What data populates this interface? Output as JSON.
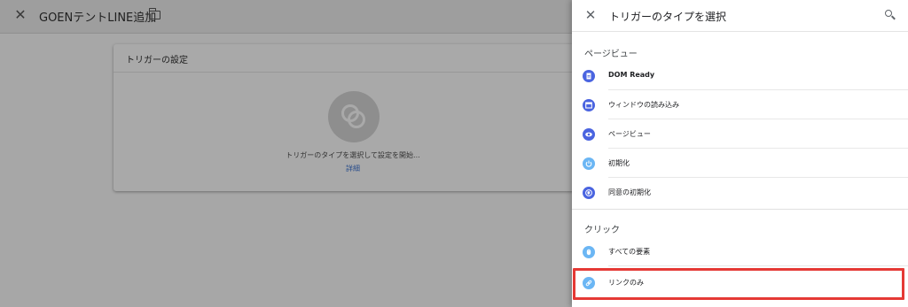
{
  "editor": {
    "title": "GOENテントLINE追加",
    "close_symbol": "✕",
    "card": {
      "header": "トリガーの設定",
      "hint": "トリガーのタイプを選択して設定を開始...",
      "link": "詳細"
    }
  },
  "panel": {
    "title": "トリガーのタイプを選択",
    "close_symbol": "✕",
    "sections": [
      {
        "title": "ページビュー",
        "items": [
          {
            "label": "DOM Ready",
            "icon": "document-icon"
          },
          {
            "label": "ウィンドウの読み込み",
            "icon": "window-icon"
          },
          {
            "label": "ページビュー",
            "icon": "eye-icon"
          },
          {
            "label": "初期化",
            "icon": "power-icon"
          },
          {
            "label": "同意の初期化",
            "icon": "consent-icon"
          }
        ]
      },
      {
        "title": "クリック",
        "items": [
          {
            "label": "すべての要素",
            "icon": "mouse-icon"
          },
          {
            "label": "リンクのみ",
            "icon": "link-icon"
          }
        ]
      }
    ]
  },
  "colors": {
    "icon_blue": "#4a64e0",
    "icon_light_blue": "#6bb6f4",
    "highlight_red": "#e53935",
    "link_blue": "#2b4f8c"
  }
}
